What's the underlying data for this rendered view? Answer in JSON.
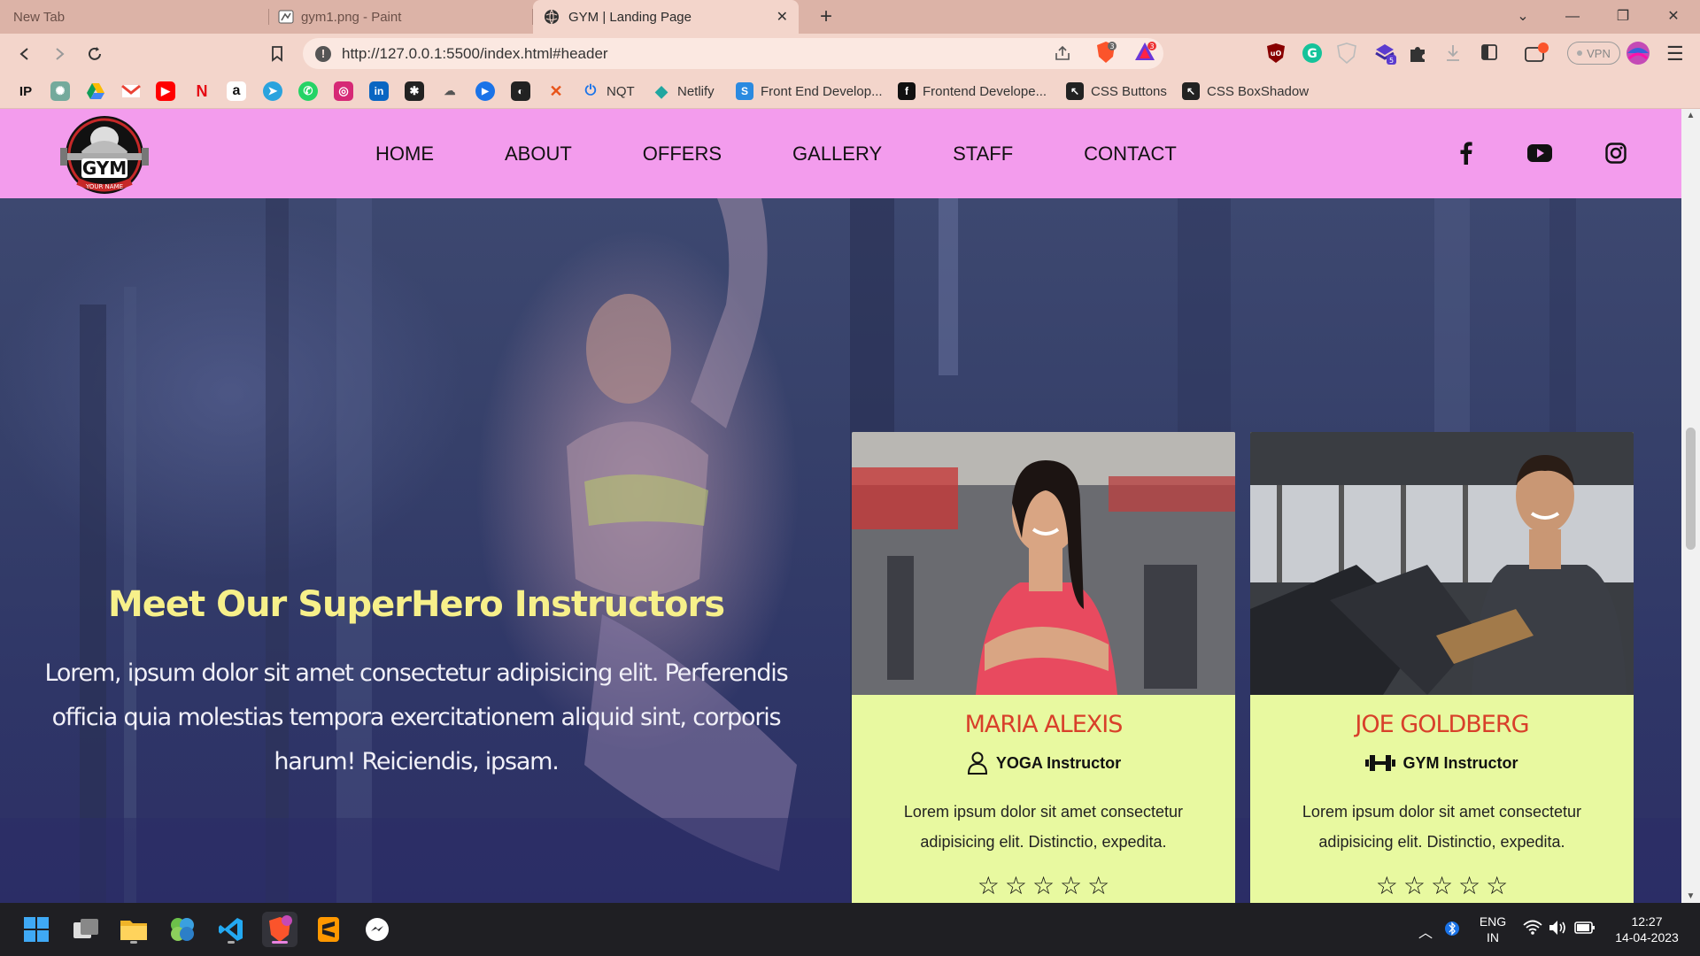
{
  "browser": {
    "tabs": [
      {
        "title": "New Tab",
        "active": false
      },
      {
        "title": "gym1.png - Paint",
        "active": false
      },
      {
        "title": "GYM | Landing Page",
        "active": true
      }
    ],
    "url": "http://127.0.0.1:5500/index.html#header",
    "vpn_label": "VPN",
    "bookmarks": [
      {
        "label": "NQT"
      },
      {
        "label": "Netlify"
      },
      {
        "label": "Front End Develop..."
      },
      {
        "label": "Frontend Develope..."
      },
      {
        "label": "CSS Buttons"
      },
      {
        "label": "CSS BoxShadow"
      }
    ]
  },
  "site": {
    "logo_text": "GYM",
    "logo_subtext": "YOUR NAME",
    "nav": [
      "HOME",
      "ABOUT",
      "OFFERS",
      "GALLERY",
      "STAFF",
      "CONTACT"
    ],
    "social_icons": [
      "facebook-icon",
      "youtube-icon",
      "instagram-icon"
    ],
    "hero": {
      "title": "Meet Our SuperHero Instructors",
      "text": "Lorem, ipsum dolor sit amet consectetur adipisicing elit. Perferendis officia quia molestias tempora exercitationem aliquid sint, corporis harum! Reiciendis, ipsam."
    },
    "instructors": [
      {
        "name": "MARIA ALEXIS",
        "role": "YOGA Instructor",
        "role_icon": "person-icon",
        "description": "Lorem ipsum dolor sit amet consectetur adipisicing elit. Distinctio, expedita.",
        "stars": [
          "☆",
          "☆",
          "☆",
          "☆",
          "☆"
        ]
      },
      {
        "name": "JOE GOLDBERG",
        "role": "GYM Instructor",
        "role_icon": "dumbbell-icon",
        "description": "Lorem ipsum dolor sit amet consectetur adipisicing elit. Distinctio, expedita.",
        "stars": [
          "☆",
          "☆",
          "☆",
          "☆",
          "☆"
        ]
      }
    ]
  },
  "taskbar": {
    "lang_line1": "ENG",
    "lang_line2": "IN",
    "time": "12:27",
    "date": "14-04-2023"
  },
  "colors": {
    "header_bg": "#f39ced",
    "card_bg": "#e8f9a0",
    "hero_title": "#f7f08a",
    "instructor_name": "#d8402a"
  }
}
